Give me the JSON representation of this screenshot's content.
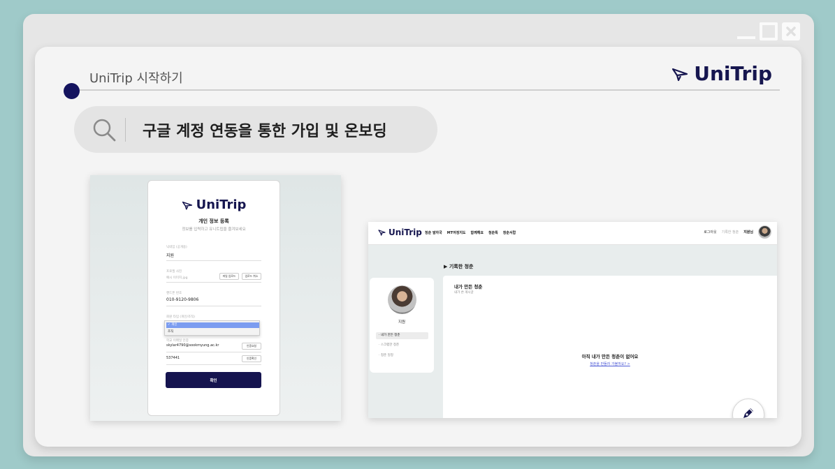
{
  "window": {
    "controls": [
      "minimize-icon",
      "maximize-icon",
      "close-icon"
    ]
  },
  "header": {
    "title": "UniTrip 시작하기",
    "brand": "UniTrip"
  },
  "search": {
    "query": "구글 계정 연동을 통한 가입 및 온보딩"
  },
  "signup_form": {
    "brand": "UniTrip",
    "title": "개인 정보 등록",
    "subtitle": "정보를 입력하고 유니트립을 즐겨보세요",
    "nickname_label": "닉네임 (공개용)",
    "nickname_value": "지원",
    "photo_label": "프로필 사진",
    "photo_placeholder": "예시 이미지.jpg",
    "photo_upload_btn": "파일 업로드",
    "photo_cancel_btn": "업로드 취소",
    "phone_label": "핸드폰 번호",
    "phone_value": "010-9120-9806",
    "type_label": "회원 타입 (개인/조직)",
    "type_selected": "✓ 개인",
    "type_option": "조직",
    "email_label": "학교 이메일 인증",
    "email_value": "skylar4790@sookmyung.ac.kr",
    "email_btn": "인증요청",
    "code_value": "537441",
    "code_btn": "인증확인",
    "submit": "확인"
  },
  "app": {
    "brand": "UniTrip",
    "nav": [
      "청춘 발자국",
      "MT여정지도",
      "함께해요",
      "청춘톡",
      "청춘서랍"
    ],
    "nav_right": {
      "logout": "로그아웃",
      "recorded": "기록한 청춘",
      "user": "지원님"
    },
    "section_title": "▶ 기록한 청춘",
    "profile": {
      "name": "지원",
      "menu_active": "· 내가 만든 청춘",
      "menu": [
        "· 스크랩한 청춘",
        "· 청춘 일정"
      ]
    },
    "content": {
      "title": "내가 만든 청춘",
      "subtitle": "내가 쓴 게시글",
      "empty": "아직 내가 만든 청춘이 없어요",
      "link": "청춘을 만들러 가볼까요? >"
    }
  },
  "colors": {
    "background": "#9fcac9",
    "brand_navy": "#16164f",
    "dot": "#14135e"
  }
}
